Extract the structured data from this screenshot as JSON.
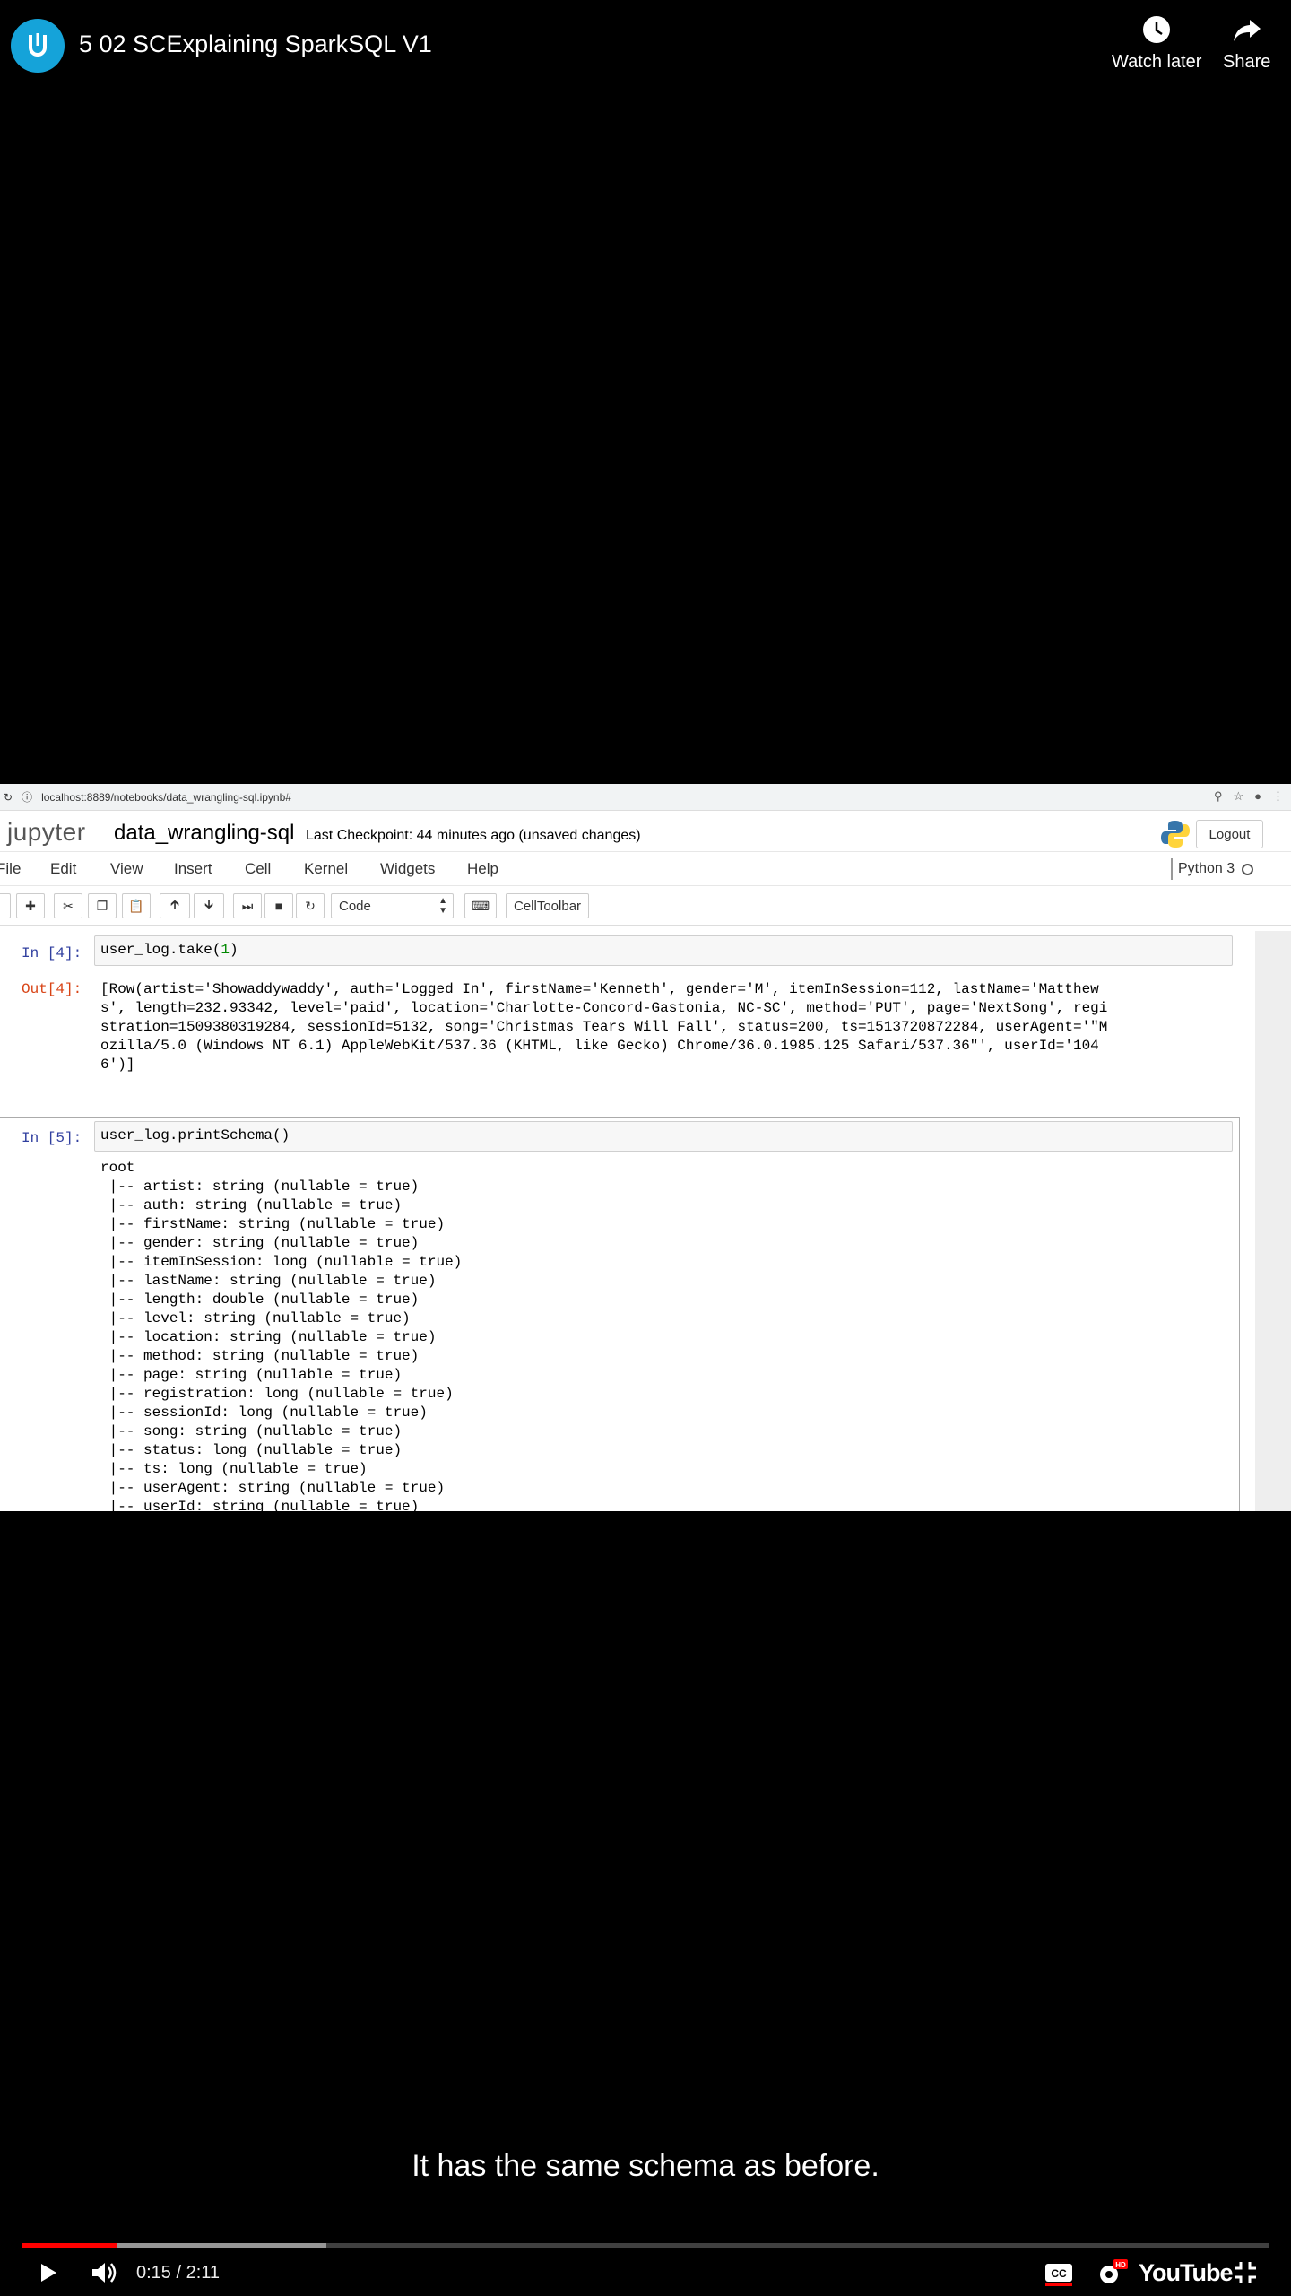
{
  "video": {
    "title": "5 02 SCExplaining SparkSQL V1",
    "watch_later": "Watch later",
    "share": "Share",
    "caption": "It has the same schema as before.",
    "time": "0:15 / 2:11",
    "played_fraction": 0.0763,
    "buffered_fraction": 0.2443,
    "brand": "YouTube"
  },
  "browser": {
    "url": "localhost:8889/notebooks/data_wrangling-sql.ipynb#"
  },
  "notebook": {
    "logo": "jupyter",
    "name": "data_wrangling-sql",
    "checkpoint": "Last Checkpoint: 44 minutes ago (unsaved changes)",
    "logout": "Logout",
    "menu": [
      "File",
      "Edit",
      "View",
      "Insert",
      "Cell",
      "Kernel",
      "Widgets",
      "Help"
    ],
    "kernel": "Python 3",
    "cell_type": "Code",
    "celltoolbar": "CellToolbar",
    "cells": [
      {
        "in_prompt": "In [4]:",
        "code_fn": "user_log.take(",
        "code_arg": "1",
        "code_close": ")",
        "out_prompt": "Out[4]:",
        "output": "[Row(artist='Showaddywaddy', auth='Logged In', firstName='Kenneth', gender='M', itemInSession=112, lastName='Matthew\ns', length=232.93342, level='paid', location='Charlotte-Concord-Gastonia, NC-SC', method='PUT', page='NextSong', regi\nstration=1509380319284, sessionId=5132, song='Christmas Tears Will Fall', status=200, ts=1513720872284, userAgent='\"M\nozilla/5.0 (Windows NT 6.1) AppleWebKit/537.36 (KHTML, like Gecko) Chrome/36.0.1985.125 Safari/537.36\"', userId='104\n6')]"
      },
      {
        "in_prompt": "In [5]:",
        "code": "user_log.printSchema()",
        "output": "root\n |-- artist: string (nullable = true)\n |-- auth: string (nullable = true)\n |-- firstName: string (nullable = true)\n |-- gender: string (nullable = true)\n |-- itemInSession: long (nullable = true)\n |-- lastName: string (nullable = true)\n |-- length: double (nullable = true)\n |-- level: string (nullable = true)\n |-- location: string (nullable = true)\n |-- method: string (nullable = true)\n |-- page: string (nullable = true)\n |-- registration: long (nullable = true)\n |-- sessionId: long (nullable = true)\n |-- song: string (nullable = true)\n |-- status: long (nullable = true)\n |-- ts: long (nullable = true)\n |-- userAgent: string (nullable = true)\n |-- userId: string (nullable = true)"
      }
    ]
  },
  "colors": {
    "progress": "#ff0000",
    "channel": "#15a3d9",
    "in_prompt": "#303f9f",
    "out_prompt": "#d84315"
  }
}
